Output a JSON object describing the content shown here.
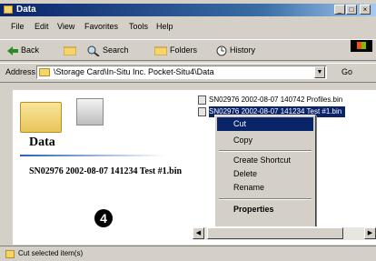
{
  "window": {
    "title": "Data"
  },
  "caption_buttons": {
    "minimize": "_",
    "maximize": "□",
    "close": "×"
  },
  "menubar": {
    "items": [
      "File",
      "Edit",
      "View",
      "Favorites",
      "Tools",
      "Help"
    ]
  },
  "toolbar": {
    "back": "Back",
    "search": "Search",
    "folders": "Folders",
    "history": "History"
  },
  "address": {
    "label": "Address",
    "path": "\\Storage Card\\In-Situ Inc. Pocket-Situ4\\Data",
    "go": "Go"
  },
  "left_pane": {
    "title": "Data",
    "selected_name": "SN02976 2002-08-07 141234 Test #1.bin"
  },
  "files": [
    {
      "name": "SN02976 2002-08-07 140742 Profiles.bin",
      "selected": false
    },
    {
      "name": "SN02976 2002-08-07 141234 Test #1.bin",
      "selected": true
    }
  ],
  "context_menu": {
    "cut": "Cut",
    "copy": "Copy",
    "create_shortcut": "Create Shortcut",
    "delete": "Delete",
    "rename": "Rename",
    "properties": "Properties"
  },
  "callout": "4",
  "status": {
    "text": "Cut selected item(s)"
  },
  "colors": {
    "highlight": "#0a246a",
    "chrome": "#d4d0c8",
    "title_gradient": "#3a6ea5"
  }
}
